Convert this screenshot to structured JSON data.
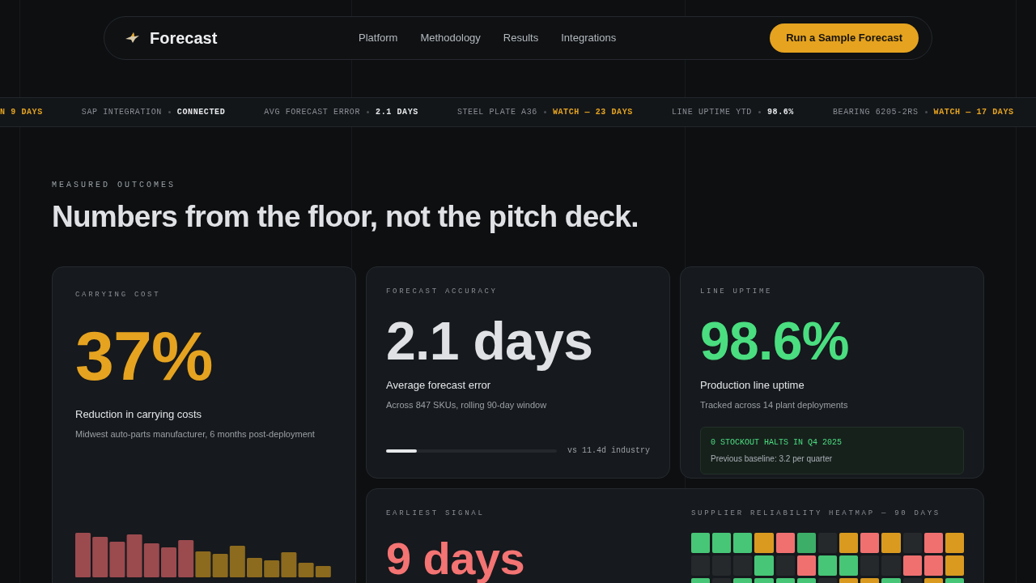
{
  "nav": {
    "brand": "Forecast",
    "links": [
      "Platform",
      "Methodology",
      "Results",
      "Integrations"
    ],
    "cta": "Run a Sample Forecast"
  },
  "ticker": [
    {
      "value": "N 9 DAYS",
      "warning": true
    },
    {
      "label": "SAP INTEGRATION",
      "value": "CONNECTED",
      "warning": false
    },
    {
      "label": "AVG FORECAST ERROR",
      "value": "2.1 DAYS",
      "warning": false
    },
    {
      "label": "STEEL PLATE A36",
      "value": "WATCH — 23 DAYS",
      "warning": true
    },
    {
      "label": "LINE UPTIME YTD",
      "value": "98.6%",
      "warning": false
    },
    {
      "label": "BEARING 6205-2RS",
      "value": "WATCH — 17 DAYS",
      "warning": true
    }
  ],
  "section": {
    "eyebrow": "MEASURED OUTCOMES",
    "heading": "Numbers from the floor, not the pitch deck."
  },
  "cards": [
    {
      "kind": "bars",
      "label": "CARRYING COST",
      "value": "37%",
      "color": "#e5a320",
      "title": "Reduction in carrying costs",
      "note": "Midwest auto-parts manufacturer, 6 months post-deployment"
    },
    {
      "kind": "progress",
      "label": "FORECAST ACCURACY",
      "value": "2.1 days",
      "color": "#dfe1e4",
      "title": "Average forecast error",
      "note": "Across 847 SKUs, rolling 90-day window",
      "level": 0.18,
      "reading": "vs 11.4d industry"
    },
    {
      "kind": "callout",
      "label": "LINE UPTIME",
      "value": "98.6%",
      "color": "#4ade80",
      "title": "Production line uptime",
      "note": "Tracked across 14 plant deployments",
      "callout_title": "0 STOCKOUT HALTS IN Q4 2025",
      "callout_note": "Previous baseline: 3.2 per quarter"
    },
    {
      "kind": "heatmap",
      "label": "EARLIEST SIGNAL",
      "value": "9 days",
      "color": "#f47373",
      "heatmap_title": "SUPPLIER RELIABILITY HEATMAP — 90 DAYS",
      "rows": [
        {
          "cells": [
            {
              "color": "#47c677"
            },
            {
              "color": "#47c677"
            },
            {
              "color": "#47c677"
            },
            {
              "color": "#d99a1f"
            },
            {
              "color": "#f07070"
            },
            {
              "color": "#3cae68"
            },
            {
              "color": "#26292c"
            },
            {
              "color": "#d99a1f"
            },
            {
              "color": "#f07070"
            },
            {
              "color": "#d99a1f"
            },
            {
              "color": "#26292c"
            },
            {
              "color": "#f07070"
            },
            {
              "color": "#d99a1f"
            }
          ]
        },
        {
          "cells": [
            {
              "color": "#26292c"
            },
            {
              "color": "#26292c"
            },
            {
              "color": "#26292c"
            },
            {
              "color": "#47c677"
            },
            {
              "color": "#26292c"
            },
            {
              "color": "#f07070"
            },
            {
              "color": "#47c677"
            },
            {
              "color": "#47c677"
            },
            {
              "color": "#26292c"
            },
            {
              "color": "#26292c"
            },
            {
              "color": "#f07070"
            },
            {
              "color": "#f07070"
            },
            {
              "color": "#d99a1f"
            }
          ]
        },
        {
          "cells": [
            {
              "color": "#47c677"
            },
            {
              "color": "#26292c"
            },
            {
              "color": "#47c677"
            },
            {
              "color": "#47c677"
            },
            {
              "color": "#47c677"
            },
            {
              "color": "#47c677"
            },
            {
              "color": "#26292c"
            },
            {
              "color": "#d99a1f"
            },
            {
              "color": "#d99a1f"
            },
            {
              "color": "#47c677"
            },
            {
              "color": "#26292c"
            },
            {
              "color": "#d99a1f"
            },
            {
              "color": "#47c677"
            }
          ]
        }
      ]
    }
  ]
}
